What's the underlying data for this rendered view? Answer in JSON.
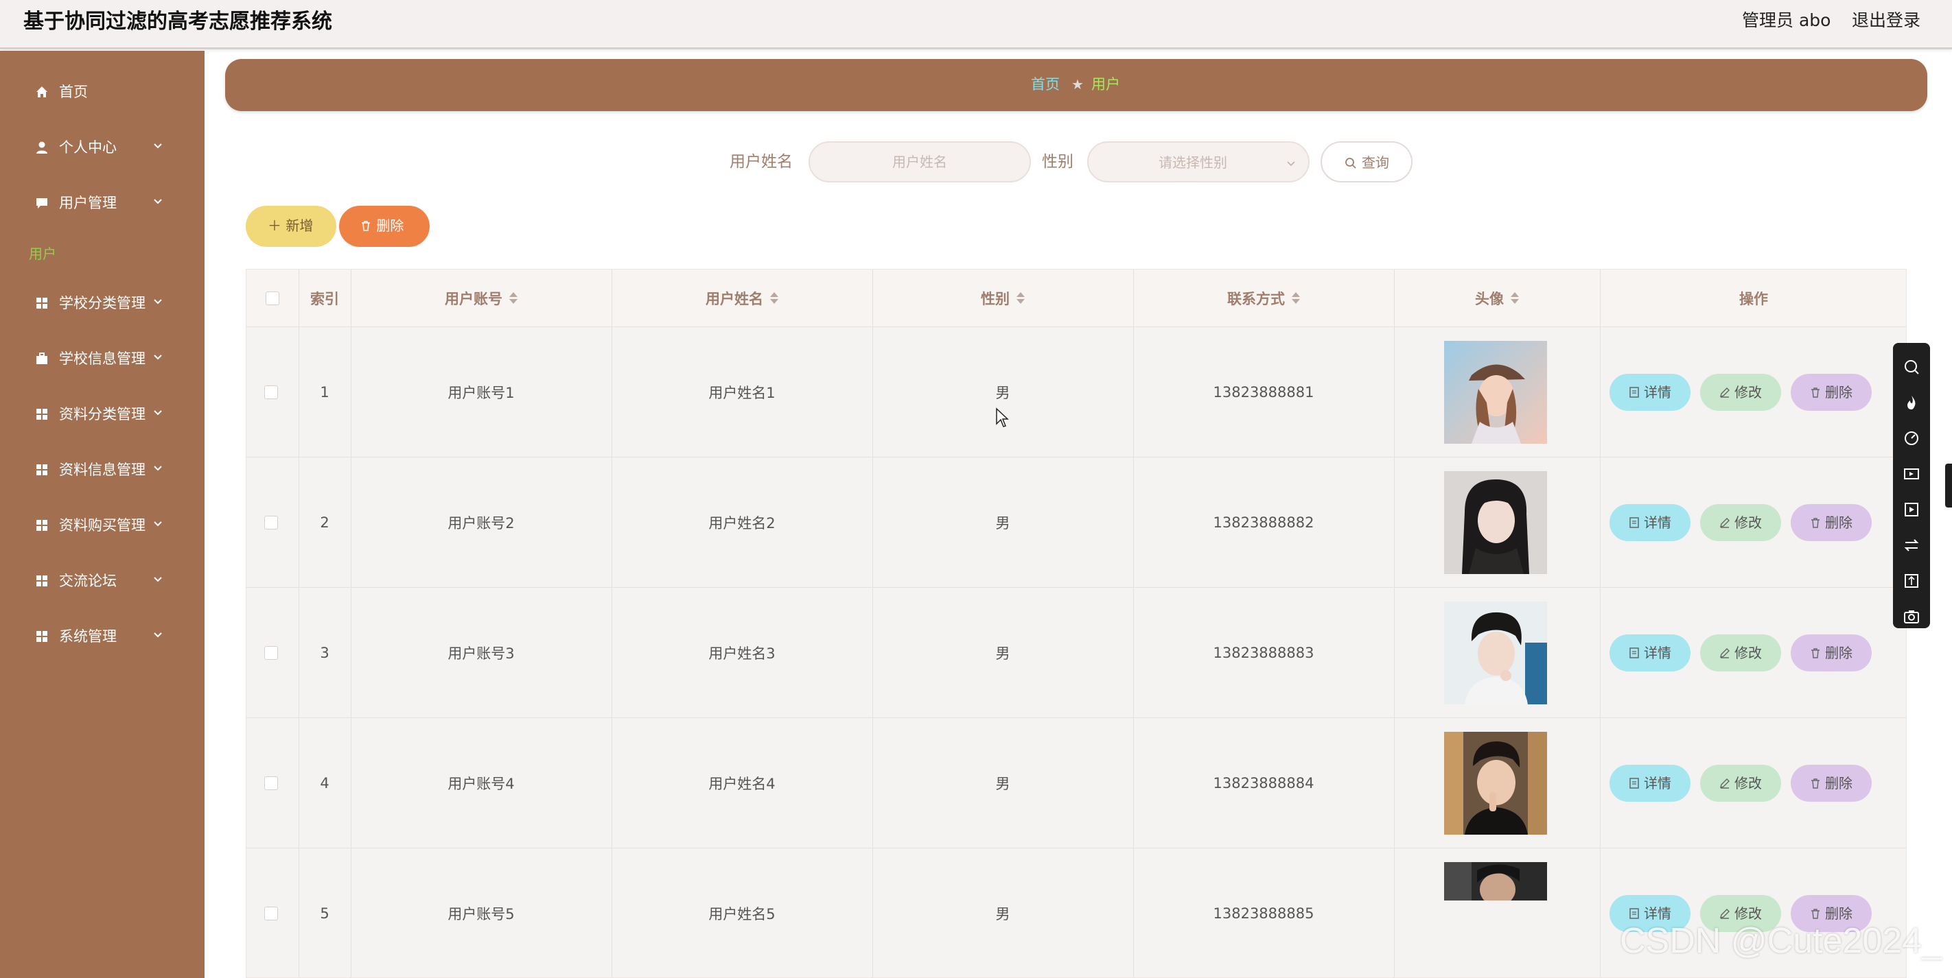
{
  "header": {
    "title": "基于协同过滤的高考志愿推荐系统",
    "admin_label": "管理员 abo",
    "logout_label": "退出登录"
  },
  "sidebar": {
    "items": [
      {
        "label": "首页",
        "icon": "home-icon",
        "has_chevron": false
      },
      {
        "label": "个人中心",
        "icon": "user-icon",
        "has_chevron": true
      },
      {
        "label": "用户管理",
        "icon": "chat-icon",
        "has_chevron": true
      },
      {
        "label": "学校分类管理",
        "icon": "grid-icon",
        "has_chevron": true
      },
      {
        "label": "学校信息管理",
        "icon": "briefcase-icon",
        "has_chevron": true
      },
      {
        "label": "资料分类管理",
        "icon": "grid-icon",
        "has_chevron": true
      },
      {
        "label": "资料信息管理",
        "icon": "grid-icon",
        "has_chevron": true
      },
      {
        "label": "资料购买管理",
        "icon": "grid-icon",
        "has_chevron": true
      },
      {
        "label": "交流论坛",
        "icon": "grid-icon",
        "has_chevron": true
      },
      {
        "label": "系统管理",
        "icon": "grid-icon",
        "has_chevron": true
      }
    ],
    "active_submenu": "用户"
  },
  "breadcrumb": {
    "home": "首页",
    "separator": "★",
    "current": "用户"
  },
  "search": {
    "name_label": "用户姓名",
    "name_placeholder": "用户姓名",
    "name_value": "",
    "gender_label": "性别",
    "gender_placeholder": "请选择性别",
    "query_label": "查询"
  },
  "actions": {
    "add_label": "新增",
    "delete_label": "删除"
  },
  "table": {
    "columns": [
      "索引",
      "用户账号",
      "用户姓名",
      "性别",
      "联系方式",
      "头像",
      "操作"
    ],
    "sortable": [
      false,
      true,
      true,
      true,
      true,
      true,
      false
    ],
    "rows": [
      {
        "index": "1",
        "account": "用户账号1",
        "name": "用户姓名1",
        "gender": "男",
        "phone": "13823888881",
        "avatar": "girl-cap-photo"
      },
      {
        "index": "2",
        "account": "用户账号2",
        "name": "用户姓名2",
        "gender": "男",
        "phone": "13823888882",
        "avatar": "girl-dark-hair-photo"
      },
      {
        "index": "3",
        "account": "用户账号3",
        "name": "用户姓名3",
        "gender": "男",
        "phone": "13823888883",
        "avatar": "boy-white-sweater-photo"
      },
      {
        "index": "4",
        "account": "用户账号4",
        "name": "用户姓名4",
        "gender": "男",
        "phone": "13823888884",
        "avatar": "boy-hand-face-photo"
      },
      {
        "index": "5",
        "account": "用户账号5",
        "name": "用户姓名5",
        "gender": "男",
        "phone": "13823888885",
        "avatar": "boy-partial-photo"
      }
    ],
    "row_actions": {
      "detail": "详情",
      "edit": "修改",
      "delete": "删除"
    }
  },
  "floating_toolbar": {
    "icons": [
      "zoom-icon",
      "fire-icon",
      "speed-icon",
      "video-icon",
      "play-box-icon",
      "swap-icon",
      "compress-icon",
      "camera-icon"
    ]
  },
  "watermark": "CSDN @Cute2024_",
  "colors": {
    "brand": "#a26f50",
    "topbar": "#f4f0ef",
    "add_button": "#f1d97a",
    "delete_button": "#f08144",
    "detail_button": "#a5e6f0",
    "edit_button": "#c8e7cd",
    "row_delete_button": "#dbc6ea",
    "active_link": "#8ed04b"
  }
}
